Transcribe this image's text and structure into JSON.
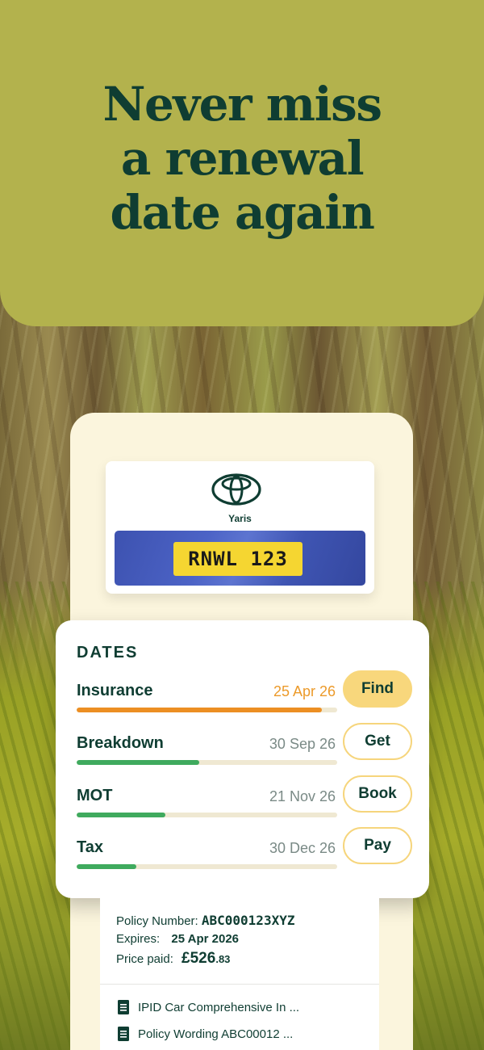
{
  "hero": {
    "headline_line1": "Never miss",
    "headline_line2": "a renewal",
    "headline_line3": "date again"
  },
  "vehicle": {
    "logo": "toyota-logo",
    "model": "Yaris",
    "registration": "RNWL 123"
  },
  "dates": {
    "heading": "DATES",
    "items": [
      {
        "label": "Insurance",
        "date": "25 Apr 26",
        "progress": 0.94,
        "status": "warning",
        "action": "Find"
      },
      {
        "label": "Breakdown",
        "date": "30 Sep 26",
        "progress": 0.47,
        "status": "ok",
        "action": "Get"
      },
      {
        "label": "MOT",
        "date": "21 Nov 26",
        "progress": 0.34,
        "status": "ok",
        "action": "Book"
      },
      {
        "label": "Tax",
        "date": "30 Dec 26",
        "progress": 0.23,
        "status": "ok",
        "action": "Pay"
      }
    ]
  },
  "policy": {
    "number_label": "Policy Number:",
    "number_value": "ABC000123XYZ",
    "expires_label": "Expires:",
    "expires_value": "25 Apr 2026",
    "price_label": "Price paid:",
    "price_major": "£526",
    "price_minor": ".83",
    "documents": [
      {
        "icon": "document-icon",
        "title": "IPID Car Comprehensive In ..."
      },
      {
        "icon": "document-icon",
        "title": "Policy Wording ABC00012 ..."
      }
    ]
  },
  "colors": {
    "hero_bg": "#b3b24d",
    "brand_text": "#0f3d32",
    "warning": "#ec8f23",
    "ok": "#3faa5e",
    "button_yellow": "#f8d77c",
    "card_cream": "#fbf5dd"
  }
}
